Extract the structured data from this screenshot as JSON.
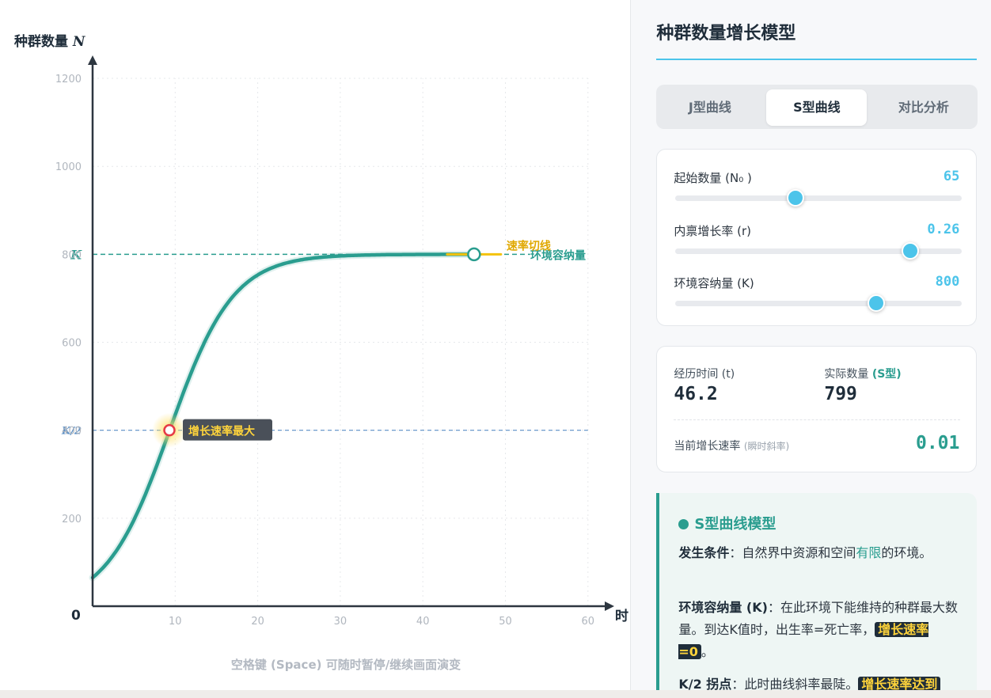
{
  "plot": {
    "y_axis_label_cn": "种群数量",
    "y_axis_label_var": "N",
    "x_axis_label": "时",
    "origin_label": "0",
    "k_label": "K",
    "k_half_label": "K/2",
    "k_line_label": "环境容纳量",
    "tangent_label": "速率切线",
    "inflection_label": "增长速率最大",
    "footer_hint": "空格键 (Space) 可随时暂停/继续画面演变",
    "y_ticks": [
      "200",
      "400",
      "600",
      "800",
      "1000",
      "1200"
    ],
    "x_ticks": [
      "10",
      "20",
      "30",
      "40",
      "50",
      "60"
    ]
  },
  "chart_data": {
    "type": "line",
    "title": "",
    "xlabel": "时",
    "ylabel": "种群数量 N",
    "xlim": [
      0,
      60
    ],
    "ylim": [
      0,
      1200
    ],
    "y_ticks": [
      200,
      400,
      600,
      800,
      1000,
      1200
    ],
    "x_ticks": [
      10,
      20,
      30,
      40,
      50,
      60
    ],
    "grid": true,
    "model": "logistic",
    "N0": 65,
    "r": 0.26,
    "K": 800,
    "t_current": 46.2,
    "series": [
      {
        "x": [
          0,
          2,
          4,
          6,
          8,
          9.3,
          10,
          12,
          14,
          16,
          18,
          20,
          22,
          24,
          26,
          28,
          30,
          32,
          34,
          36,
          38,
          40,
          42,
          44,
          46.2
        ],
        "y": [
          65,
          107,
          172,
          264,
          381,
          400,
          476,
          584,
          669,
          726,
          760,
          779,
          789,
          794,
          797,
          798,
          799,
          800,
          800,
          800,
          800,
          800,
          800,
          800,
          799
        ]
      }
    ],
    "reference_lines": [
      {
        "y": 800,
        "label": "K"
      },
      {
        "y": 400,
        "label": "K/2"
      }
    ],
    "annotations": [
      {
        "x": 9.3,
        "y": 400,
        "text": "增长速率最大"
      },
      {
        "x": 46.2,
        "y": 799,
        "text": "速率切线"
      }
    ],
    "colors": {
      "curve": "#2a9d8f",
      "k_line": "#2a9d8f",
      "k_half_line": "#5b8fc6",
      "inflection": "#e63946",
      "tangent": "#f4c20d"
    }
  },
  "panel": {
    "title": "种群数量增长模型",
    "tabs": [
      {
        "label": "J型曲线",
        "active": false
      },
      {
        "label": "S型曲线",
        "active": true
      },
      {
        "label": "对比分析",
        "active": false
      }
    ],
    "controls": [
      {
        "label": "起始数量 (N₀ )",
        "value": "65",
        "fraction": 0.42
      },
      {
        "label": "内禀增长率 (r)",
        "value": "0.26",
        "fraction": 0.82
      },
      {
        "label": "环境容纳量 (K)",
        "value": "800",
        "fraction": 0.7
      }
    ],
    "stats": {
      "time_label": "经历时间 (t)",
      "time_value": "46.2",
      "count_label": "实际数量",
      "count_tag": "(S型)",
      "count_value": "799",
      "rate_label": "当前增长速率",
      "rate_hint": "(瞬时斜率)",
      "rate_value": "0.01"
    },
    "info": {
      "title": "S型曲线模型",
      "p1_key": "发生条件",
      "p1_a": "：自然界中资源和空间",
      "p1_em": "有限",
      "p1_b": "的环境。",
      "p2_key": "环境容纳量 (K)",
      "p2_a": "：在此环境下能维持的种群最大数量。到达K值时，出生率=死亡率，",
      "p2_hl": "增长速率=0",
      "p2_b": "。",
      "p3_key": "K/2 拐点",
      "p3_a": "：此时曲线斜率最陡。",
      "p3_hl": "增长速率达到"
    }
  },
  "colors": {
    "accent": "#4cc4ea",
    "teal": "#2a9d8f",
    "dark": "#1f2d3a"
  }
}
